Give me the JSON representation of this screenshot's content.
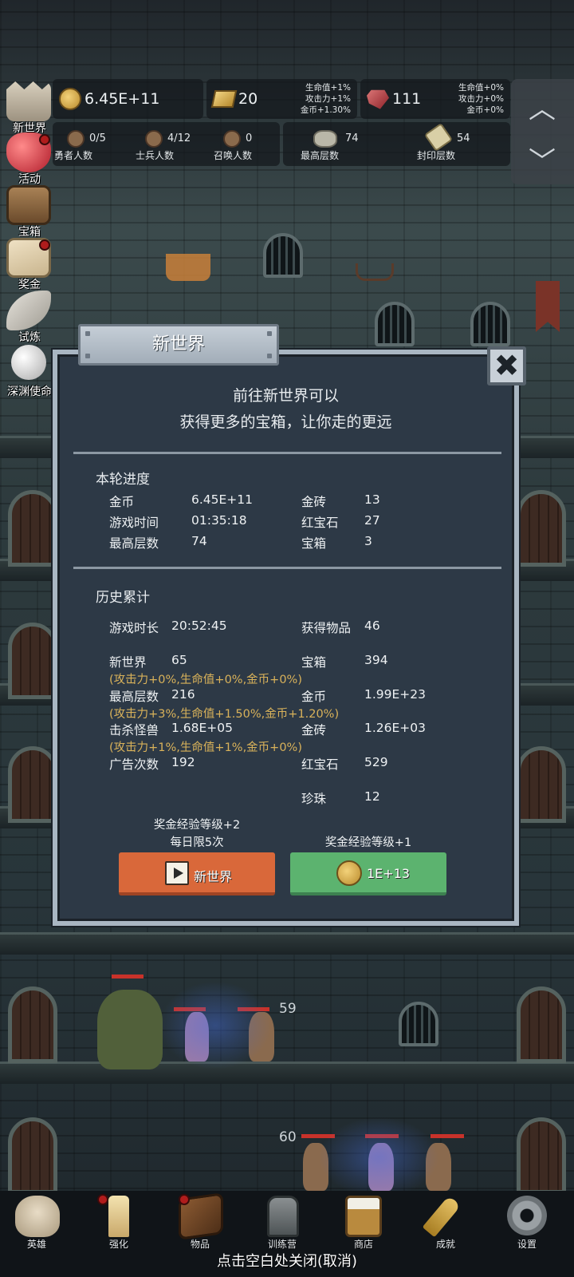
{
  "resources": {
    "gold": {
      "value": "6.45E+11",
      "icon": "gold-coin-icon"
    },
    "gold_brick": {
      "value": "20",
      "icon": "gold-brick-icon",
      "bonus": [
        "生命值+1%",
        "攻击力+1%",
        "金币+1.30%"
      ]
    },
    "ruby": {
      "value": "111",
      "icon": "ruby-icon",
      "bonus": [
        "生命值+0%",
        "攻击力+0%",
        "金币+0%"
      ]
    }
  },
  "counts": [
    {
      "label": "勇者人数",
      "value": "0/5",
      "icon": "hero-head-icon"
    },
    {
      "label": "士兵人数",
      "value": "4/12",
      "icon": "soldier-head-icon"
    },
    {
      "label": "召唤人数",
      "value": "0",
      "icon": "summon-head-icon"
    },
    {
      "label": "最高层数",
      "value": "74",
      "icon": "stone-icon"
    },
    {
      "label": "封印层数",
      "value": "54",
      "icon": "scroll-icon"
    }
  ],
  "side_menu": [
    {
      "label": "新世界",
      "icon": "castle-icon",
      "badge": false
    },
    {
      "label": "活动",
      "icon": "heart-icon",
      "badge": true
    },
    {
      "label": "宝箱",
      "icon": "treasure-chest-icon",
      "badge": false
    },
    {
      "label": "奖金",
      "icon": "envelope-icon",
      "badge": true
    },
    {
      "label": "试炼",
      "icon": "feather-icon",
      "badge": false
    },
    {
      "label": "深渊使命",
      "icon": "pearl-icon",
      "badge": false
    }
  ],
  "scene": {
    "floor_numbers": [
      "59",
      "60"
    ]
  },
  "dialog": {
    "title": "新世界",
    "close_symbol": "✖",
    "intro_line1": "前往新世界可以",
    "intro_line2": "获得更多的宝箱，让你走的更远",
    "current": {
      "title": "本轮进度",
      "rows": [
        {
          "l_label": "金币",
          "l_value": "6.45E+11",
          "r_label": "金砖",
          "r_value": "13"
        },
        {
          "l_label": "游戏时间",
          "l_value": "01:35:18",
          "r_label": "红宝石",
          "r_value": "27"
        },
        {
          "l_label": "最高层数",
          "l_value": "74",
          "r_label": "宝箱",
          "r_value": "3"
        }
      ]
    },
    "history": {
      "title": "历史累计",
      "play_time": {
        "label": "游戏时长",
        "value": "20:52:45"
      },
      "items": {
        "label": "获得物品",
        "value": "46"
      },
      "new_world": {
        "label": "新世界",
        "value": "65",
        "bonus": "(攻击力+0%,生命值+0%,金币+0%)"
      },
      "chests": {
        "label": "宝箱",
        "value": "394"
      },
      "max_floor": {
        "label": "最高层数",
        "value": "216",
        "bonus": "(攻击力+3%,生命值+1.50%,金币+1.20%)"
      },
      "gold": {
        "label": "金币",
        "value": "1.99E+23"
      },
      "kills": {
        "label": "击杀怪兽",
        "value": "1.68E+05",
        "bonus": "(攻击力+1%,生命值+1%,金币+0%)"
      },
      "gold_brick": {
        "label": "金砖",
        "value": "1.26E+03"
      },
      "ads": {
        "label": "广告次数",
        "value": "192"
      },
      "ruby": {
        "label": "红宝石",
        "value": "529"
      },
      "pearl": {
        "label": "珍珠",
        "value": "12"
      }
    },
    "reward_ad_line1": "奖金经验等级+2",
    "reward_ad_line2": "每日限5次",
    "reward_gold_line": "奖金经验等级+1",
    "ad_button": {
      "label": "新世界",
      "icon": "video-ad-icon"
    },
    "gold_button": {
      "label": "1E+13",
      "icon": "gold-coin-icon"
    }
  },
  "bottom_nav": [
    {
      "label": "英雄",
      "icon": "skull-icon",
      "badge": false
    },
    {
      "label": "强化",
      "icon": "candle-icon",
      "badge": true
    },
    {
      "label": "物品",
      "icon": "book-icon",
      "badge": true
    },
    {
      "label": "训练营",
      "icon": "lantern-icon",
      "badge": false
    },
    {
      "label": "商店",
      "icon": "beer-mug-icon",
      "badge": false
    },
    {
      "label": "成就",
      "icon": "key-icon",
      "badge": false
    },
    {
      "label": "设置",
      "icon": "gear-icon",
      "badge": false
    }
  ],
  "close_hint": "点击空白处关闭(取消)",
  "colors": {
    "bonus_text": "#d9b25a",
    "ad_button": "#d9683a",
    "gold_button": "#5cb36f",
    "dialog_bg": "#2d3946"
  }
}
